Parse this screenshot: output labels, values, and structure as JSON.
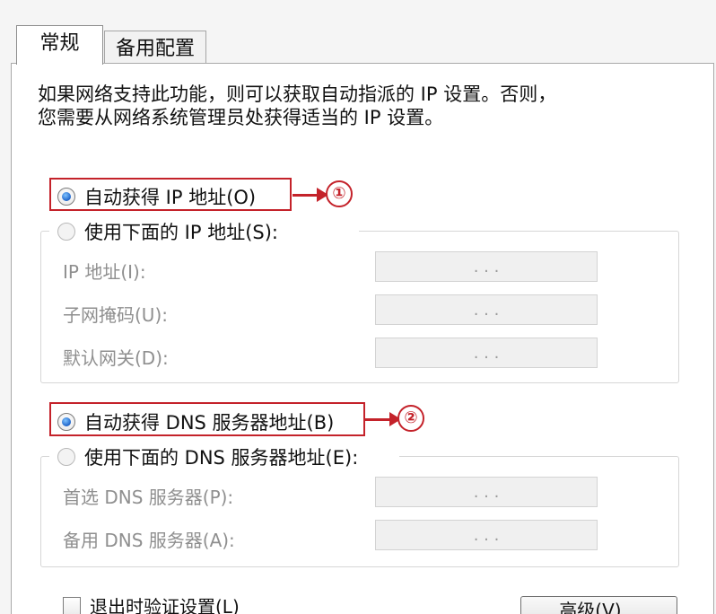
{
  "tabs": {
    "general": "常规",
    "alternate": "备用配置"
  },
  "intro": {
    "line1": "如果网络支持此功能，则可以获取自动指派的 IP 设置。否则，",
    "line2": "您需要从网络系统管理员处获得适当的 IP 设置。"
  },
  "ip_section": {
    "auto_label": "自动获得 IP 地址(O)",
    "manual_label": "使用下面的 IP 地址(S):",
    "fields": [
      {
        "label": "IP 地址(I):",
        "value": ". . ."
      },
      {
        "label": "子网掩码(U):",
        "value": ". . ."
      },
      {
        "label": "默认网关(D):",
        "value": ". . ."
      }
    ]
  },
  "dns_section": {
    "auto_label": "自动获得 DNS 服务器地址(B)",
    "manual_label": "使用下面的 DNS 服务器地址(E):",
    "fields": [
      {
        "label": "首选 DNS 服务器(P):",
        "value": ". . ."
      },
      {
        "label": "备用 DNS 服务器(A):",
        "value": ". . ."
      }
    ]
  },
  "annotations": {
    "marker_1": "①",
    "marker_2": "②"
  },
  "footer": {
    "validate_label": "退出时验证设置(L)",
    "advanced_label": "高级(V)..."
  },
  "colors": {
    "highlight": "#c4222a",
    "radio_selected": "#1d63c9",
    "disabled_text": "#8f8f8f"
  }
}
